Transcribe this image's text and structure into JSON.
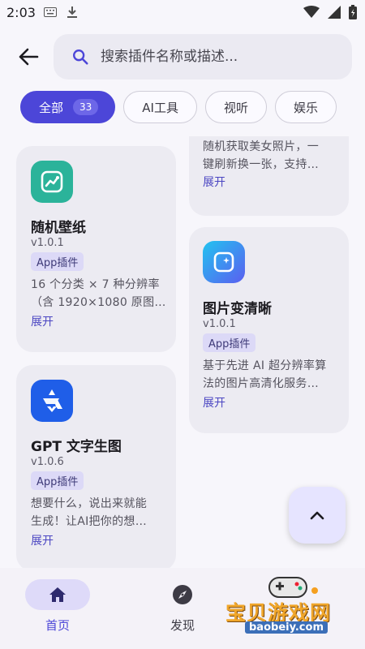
{
  "status_bar": {
    "time": "2:03",
    "icons_left": [
      "keyboard-icon",
      "download-icon"
    ],
    "icons_right": [
      "wifi-icon",
      "signal-icon",
      "battery-icon"
    ]
  },
  "search": {
    "placeholder": "搜索插件名称或描述..."
  },
  "filters": [
    {
      "label": "全部",
      "count": "33",
      "active": true
    },
    {
      "label": "AI工具"
    },
    {
      "label": "视听"
    },
    {
      "label": "娱乐"
    }
  ],
  "plugins_left": [
    {
      "title": "随机壁纸",
      "version": "v1.0.1",
      "badge": "App插件",
      "desc_line1": "16 个分类 × 7 种分辨率",
      "desc_line2": "（含 1920×1080 原图…",
      "expand": "展开",
      "icon": "chart-icon",
      "icon_color": "#2bb39a"
    },
    {
      "title": "GPT 文字生图",
      "version": "v1.0.6",
      "badge": "App插件",
      "desc_line1": "想要什么，说出来就能",
      "desc_line2": "生成！让AI把你的想…",
      "expand": "展开",
      "icon": "logo-icon",
      "icon_color": "#1f5ee8"
    }
  ],
  "plugins_right": [
    {
      "desc_line1": "随机获取美女照片，一",
      "desc_line2": "键刷新换一张，支持…",
      "expand": "展开"
    },
    {
      "title": "图片变清晰",
      "version": "v1.0.1",
      "badge": "App插件",
      "desc_line1": "基于先进 AI 超分辨率算",
      "desc_line2": "法的图片高清化服务…",
      "expand": "展开",
      "icon": "sparkle-image-icon",
      "icon_color": "#3f7ff0"
    }
  ],
  "fab": {
    "icon": "chevron-up-icon"
  },
  "bottom_nav": [
    {
      "label": "首页",
      "icon": "home-icon",
      "active": true
    },
    {
      "label": "发现",
      "icon": "compass-icon",
      "active": false
    }
  ],
  "watermark": {
    "title": "宝贝游戏网",
    "url": "baobeiy.com"
  },
  "colors": {
    "accent": "#4c46d8",
    "background": "#f7f6fb",
    "card": "#ecebf2"
  }
}
